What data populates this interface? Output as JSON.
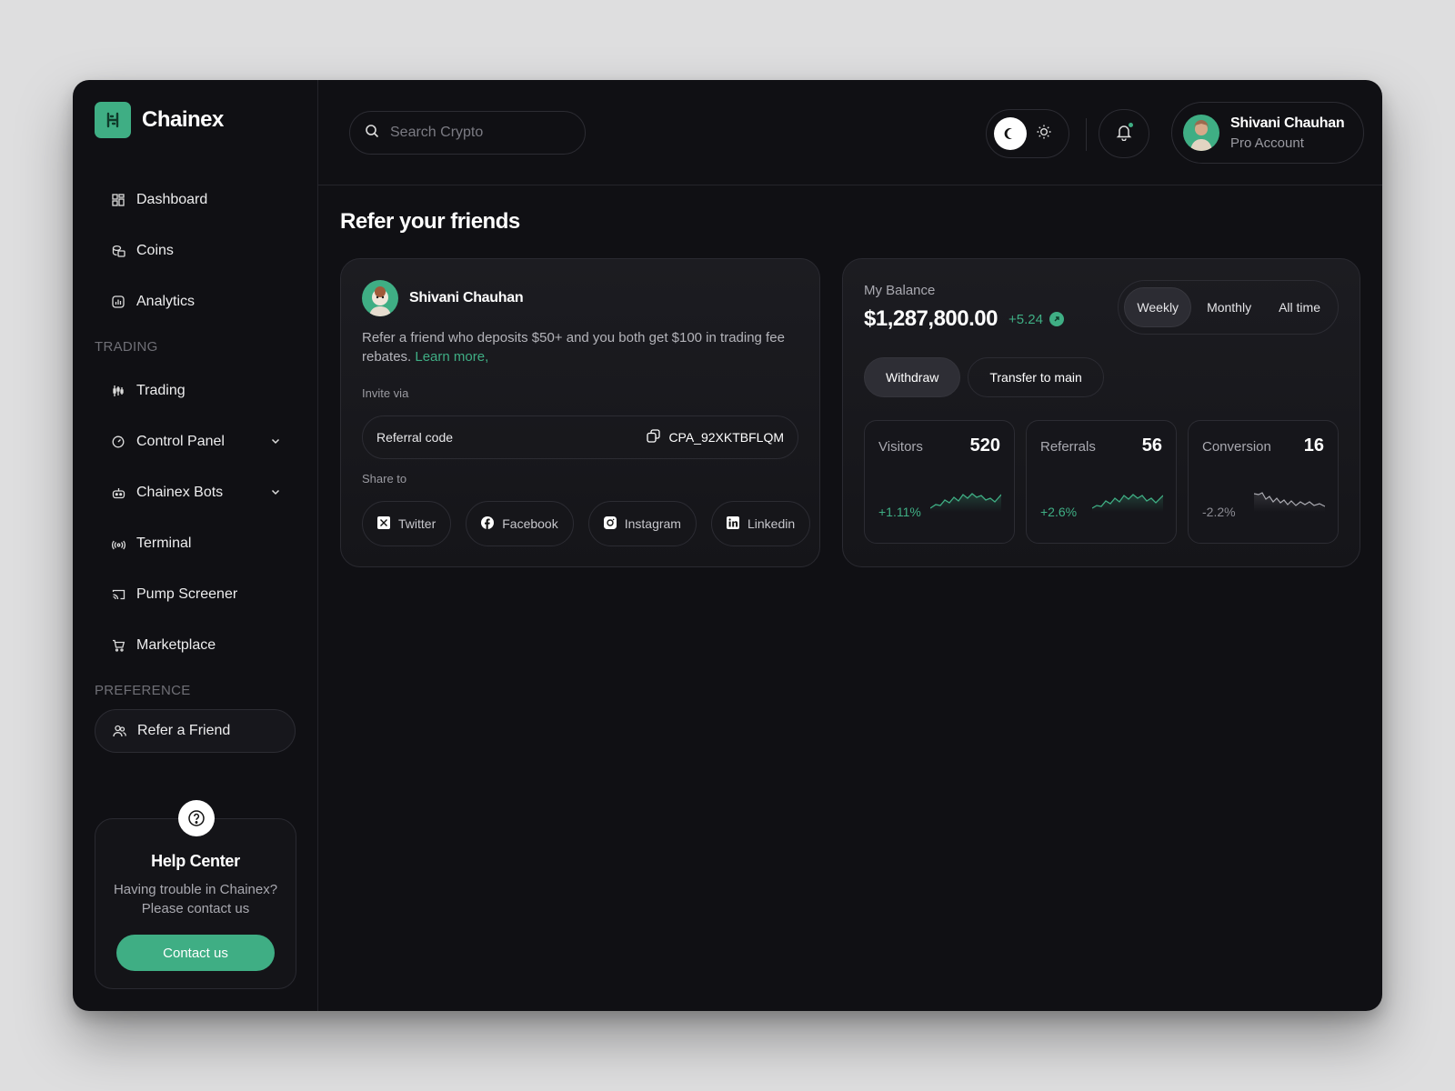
{
  "brand": {
    "name": "Chainex",
    "accent": "#3fae84"
  },
  "sidebar": {
    "items": [
      {
        "label": "Dashboard",
        "icon": "grid-icon"
      },
      {
        "label": "Coins",
        "icon": "coins-icon"
      },
      {
        "label": "Analytics",
        "icon": "analytics-icon"
      }
    ],
    "trading_title": "TRADING",
    "trading_items": [
      {
        "label": "Trading",
        "icon": "candles-icon"
      },
      {
        "label": "Control Panel",
        "icon": "gauge-icon",
        "expandable": true
      },
      {
        "label": "Chainex Bots",
        "icon": "bot-icon",
        "expandable": true
      },
      {
        "label": "Terminal",
        "icon": "signal-icon"
      },
      {
        "label": "Pump Screener",
        "icon": "cast-icon"
      },
      {
        "label": "Marketplace",
        "icon": "cart-icon"
      }
    ],
    "preference_title": "PREFERENCE",
    "preference_items": [
      {
        "label": "Refer a Friend",
        "icon": "users-icon",
        "active": true
      }
    ],
    "help": {
      "title": "Help Center",
      "line1": "Having trouble in Chainex?",
      "line2": "Please contact us",
      "button": "Contact us"
    }
  },
  "topbar": {
    "search_placeholder": "Search Crypto",
    "theme": "dark",
    "user": {
      "name": "Shivani Chauhan",
      "plan": "Pro Account"
    }
  },
  "page": {
    "title": "Refer your friends",
    "refer_card": {
      "name": "Shivani Chauhan",
      "desc": "Refer a friend who deposits $50+ and you both get $100 in trading fee rebates.",
      "learn_more": "Learn more,",
      "invite_label": "Invite via",
      "referral_label": "Referral code",
      "referral_code": "CPA_92XKTBFLQM",
      "share_label": "Share to",
      "shares": [
        {
          "label": "Twitter",
          "icon": "x-icon"
        },
        {
          "label": "Facebook",
          "icon": "facebook-icon"
        },
        {
          "label": "Instagram",
          "icon": "instagram-icon"
        },
        {
          "label": "Linkedin",
          "icon": "linkedin-icon"
        }
      ]
    },
    "balance_card": {
      "label": "My Balance",
      "amount": "$1,287,800.00",
      "change": "+5.24",
      "periods": [
        "Weekly",
        "Monthly",
        "All time"
      ],
      "active_period": "Weekly",
      "withdraw": "Withdraw",
      "transfer": "Transfer to main",
      "stats": [
        {
          "label": "Visitors",
          "value": "520",
          "change": "+1.11%",
          "trend": "up",
          "color": "#3fae84"
        },
        {
          "label": "Referrals",
          "value": "56",
          "change": "+2.6%",
          "trend": "up",
          "color": "#3fae84"
        },
        {
          "label": "Conversion",
          "value": "16",
          "change": "-2.2%",
          "trend": "down",
          "color": "#8a8a92"
        }
      ]
    }
  }
}
